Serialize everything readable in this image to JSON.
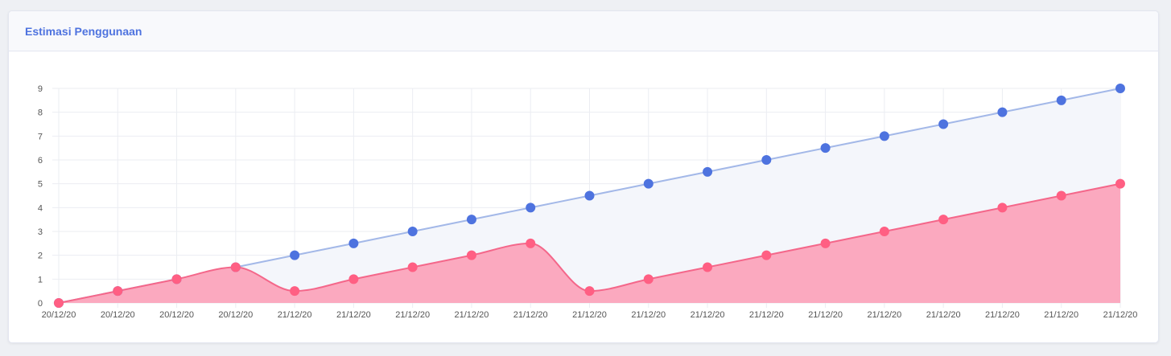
{
  "card": {
    "title": "Estimasi Penggunaan"
  },
  "colors": {
    "accent": "#4e73df",
    "series_blue_point": "#4e73df",
    "series_blue_line": "#a3b8e8",
    "series_blue_fill": "#f4f6fb",
    "series_pink_point": "#ff5f83",
    "series_pink_line": "#f4678a",
    "series_pink_fill": "#fba9bf",
    "grid": "#ebedf2",
    "tick_text": "#555555"
  },
  "chart_data": {
    "type": "area",
    "title": "",
    "xlabel": "",
    "ylabel": "",
    "ylim": [
      0,
      9
    ],
    "yticks": [
      0,
      1,
      2,
      3,
      4,
      5,
      6,
      7,
      8,
      9
    ],
    "grid": true,
    "categories": [
      "20/12/20",
      "20/12/20",
      "20/12/20",
      "20/12/20",
      "21/12/20",
      "21/12/20",
      "21/12/20",
      "21/12/20",
      "21/12/20",
      "21/12/20",
      "21/12/20",
      "21/12/20",
      "21/12/20",
      "21/12/20",
      "21/12/20",
      "21/12/20",
      "21/12/20",
      "21/12/20",
      "21/12/20"
    ],
    "series": [
      {
        "values": [
          0,
          0.5,
          1,
          1.5,
          2,
          2.5,
          3,
          3.5,
          4,
          4.5,
          5,
          5.5,
          6,
          6.5,
          7,
          7.5,
          8,
          8.5,
          9
        ]
      },
      {
        "values": [
          0,
          0.5,
          1,
          1.5,
          0.5,
          1,
          1.5,
          2,
          2.5,
          0.5,
          1,
          1.5,
          2,
          2.5,
          3,
          3.5,
          4,
          4.5,
          5
        ]
      }
    ]
  }
}
